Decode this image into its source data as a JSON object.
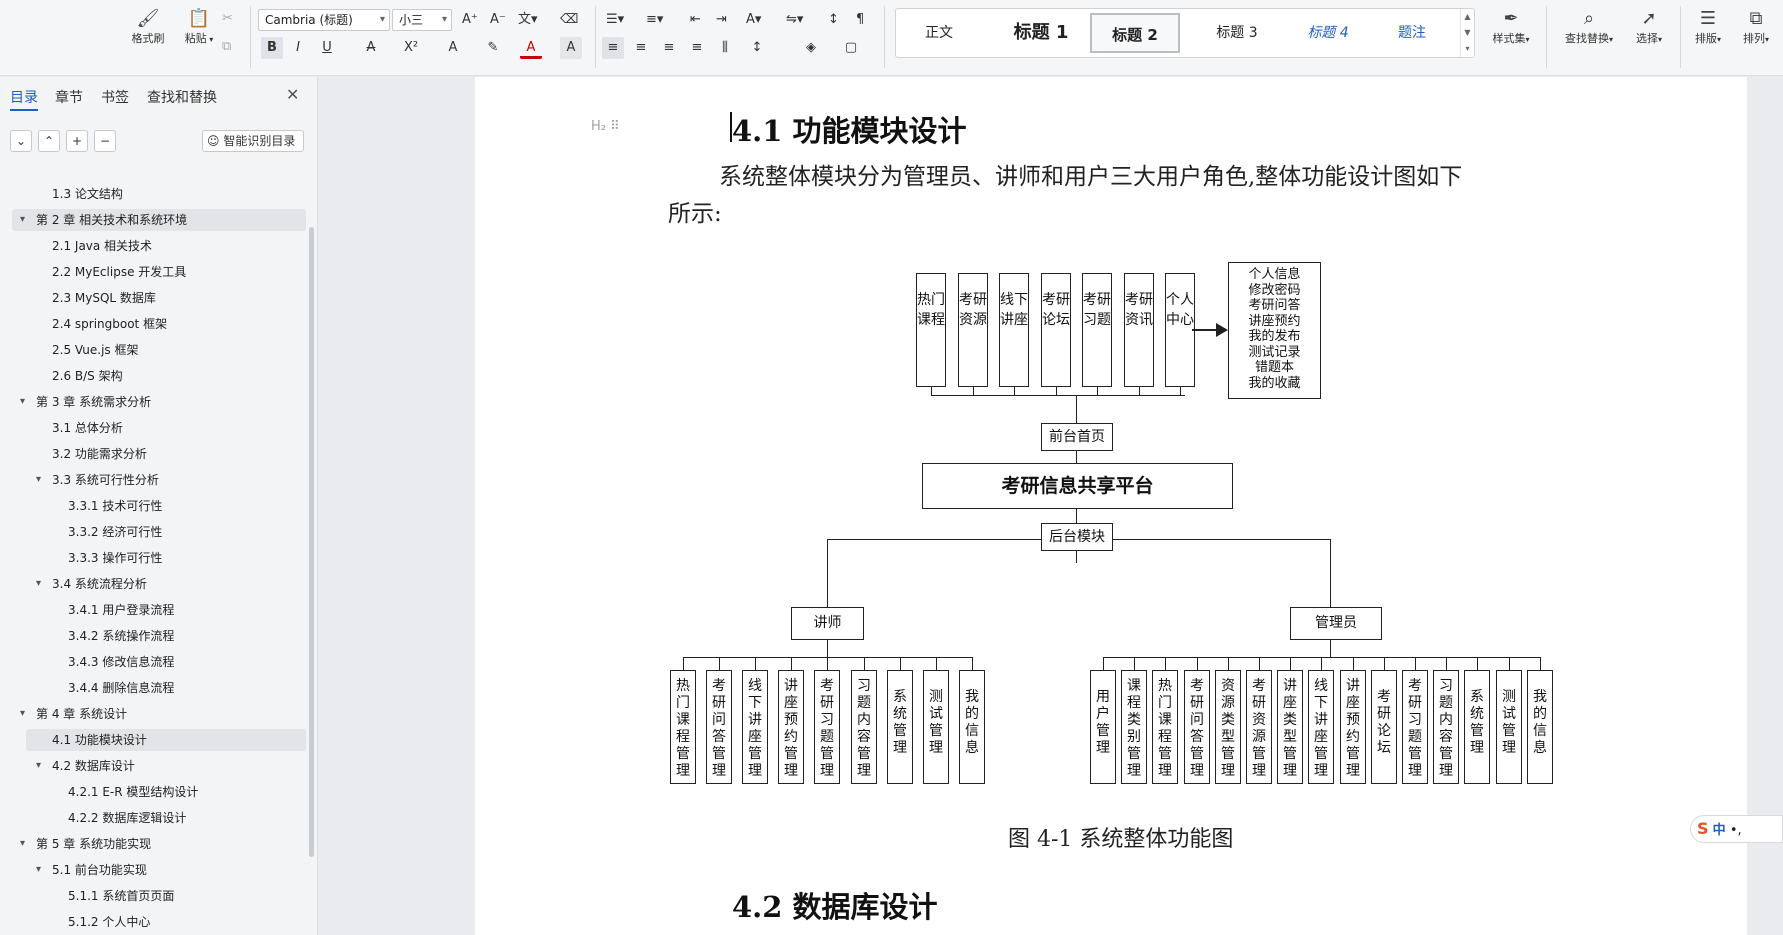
{
  "ribbon": {
    "format_painter": "格式刷",
    "paste": "粘贴",
    "font_name": "Cambria (标题)",
    "font_size": "小三",
    "styles": [
      "正文",
      "标题 1",
      "标题 2",
      "标题 3",
      "标题 4",
      "题注"
    ],
    "style_set": "样式集",
    "find_replace": "查找替换",
    "select": "选择",
    "layout": "排版",
    "columns": "排列"
  },
  "sidebar": {
    "tabs": [
      "目录",
      "章节",
      "书签",
      "查找和替换"
    ],
    "smart_toc": "智能识别目录",
    "toc": [
      {
        "label": "1.3 论文结构",
        "level": 2
      },
      {
        "label": "第 2 章  相关技术和系统环境",
        "level": 1,
        "expanded": true,
        "selected": true
      },
      {
        "label": "2.1 Java 相关技术",
        "level": 2
      },
      {
        "label": "2.2 MyEclipse 开发工具",
        "level": 2
      },
      {
        "label": "2.3 MySQL 数据库",
        "level": 2
      },
      {
        "label": "2.4 springboot 框架",
        "level": 2
      },
      {
        "label": "2.5 Vue.js 框架",
        "level": 2
      },
      {
        "label": "2.6 B/S 架构",
        "level": 2
      },
      {
        "label": "第 3 章  系统需求分析",
        "level": 1,
        "expanded": true
      },
      {
        "label": "3.1 总体分析",
        "level": 2
      },
      {
        "label": "3.2 功能需求分析",
        "level": 2
      },
      {
        "label": "3.3  系统可行性分析",
        "level": 2,
        "expanded": true
      },
      {
        "label": "3.3.1 技术可行性",
        "level": 3
      },
      {
        "label": "3.3.2 经济可行性",
        "level": 3
      },
      {
        "label": "3.3.3 操作可行性",
        "level": 3
      },
      {
        "label": "3.4 系统流程分析",
        "level": 2,
        "expanded": true
      },
      {
        "label": "3.4.1  用户登录流程",
        "level": 3
      },
      {
        "label": "3.4.2  系统操作流程",
        "level": 3
      },
      {
        "label": "3.4.3 修改信息流程",
        "level": 3
      },
      {
        "label": "3.4.4 删除信息流程",
        "level": 3
      },
      {
        "label": "第 4 章  系统设计",
        "level": 1,
        "expanded": true
      },
      {
        "label": "4.1  功能模块设计",
        "level": 2,
        "selected": true
      },
      {
        "label": "4.2  数据库设计",
        "level": 2,
        "expanded": true
      },
      {
        "label": "4.2.1 E-R 模型结构设计",
        "level": 3
      },
      {
        "label": "4.2.2  数据库逻辑设计",
        "level": 3
      },
      {
        "label": "第 5 章  系统功能实现",
        "level": 1,
        "expanded": true
      },
      {
        "label": "5.1 前台功能实现",
        "level": 2,
        "expanded": true
      },
      {
        "label": "5.1.1 系统首页页面",
        "level": 3
      },
      {
        "label": "5.1.2 个人中心",
        "level": 3
      }
    ]
  },
  "document": {
    "heading_marker": "H₂",
    "section_title": "4.1  功能模块设计",
    "paragraph_line1": "系统整体模块分为管理员、讲师和用户三大用户角色,整体功能设计图如下",
    "paragraph_line2": "所示:",
    "figure_caption": "图 4-1  系统整体功能图",
    "next_section_title": "4.2  数据库设计",
    "diagram": {
      "front_modules": [
        "热门课程",
        "考研资源",
        "线下讲座",
        "考研论坛",
        "考研习题",
        "考研资讯",
        "个人中心"
      ],
      "personal_center_items": [
        "个人信息",
        "修改密码",
        "考研问答",
        "讲座预约",
        "我的发布",
        "测试记录",
        "错题本",
        "我的收藏"
      ],
      "front_home": "前台首页",
      "platform": "考研信息共享平台",
      "backend": "后台模块",
      "lecturer": "讲师",
      "admin": "管理员",
      "lecturer_modules": [
        "热门课程管理",
        "考研问答管理",
        "线下讲座管理",
        "讲座预约管理",
        "考研习题管理",
        "习题内容管理",
        "系统管理",
        "测试管理",
        "我的信息"
      ],
      "admin_modules": [
        "用户管理",
        "课程类别管理",
        "热门课程管理",
        "考研问答管理",
        "资源类型管理",
        "考研资源管理",
        "讲座类型管理",
        "线下讲座管理",
        "讲座预约管理",
        "考研论坛",
        "考研习题管理",
        "习题内容管理",
        "系统管理",
        "测试管理",
        "我的信息"
      ]
    }
  },
  "ime": {
    "brand": "S",
    "mode": "中",
    "punct": "•,"
  }
}
